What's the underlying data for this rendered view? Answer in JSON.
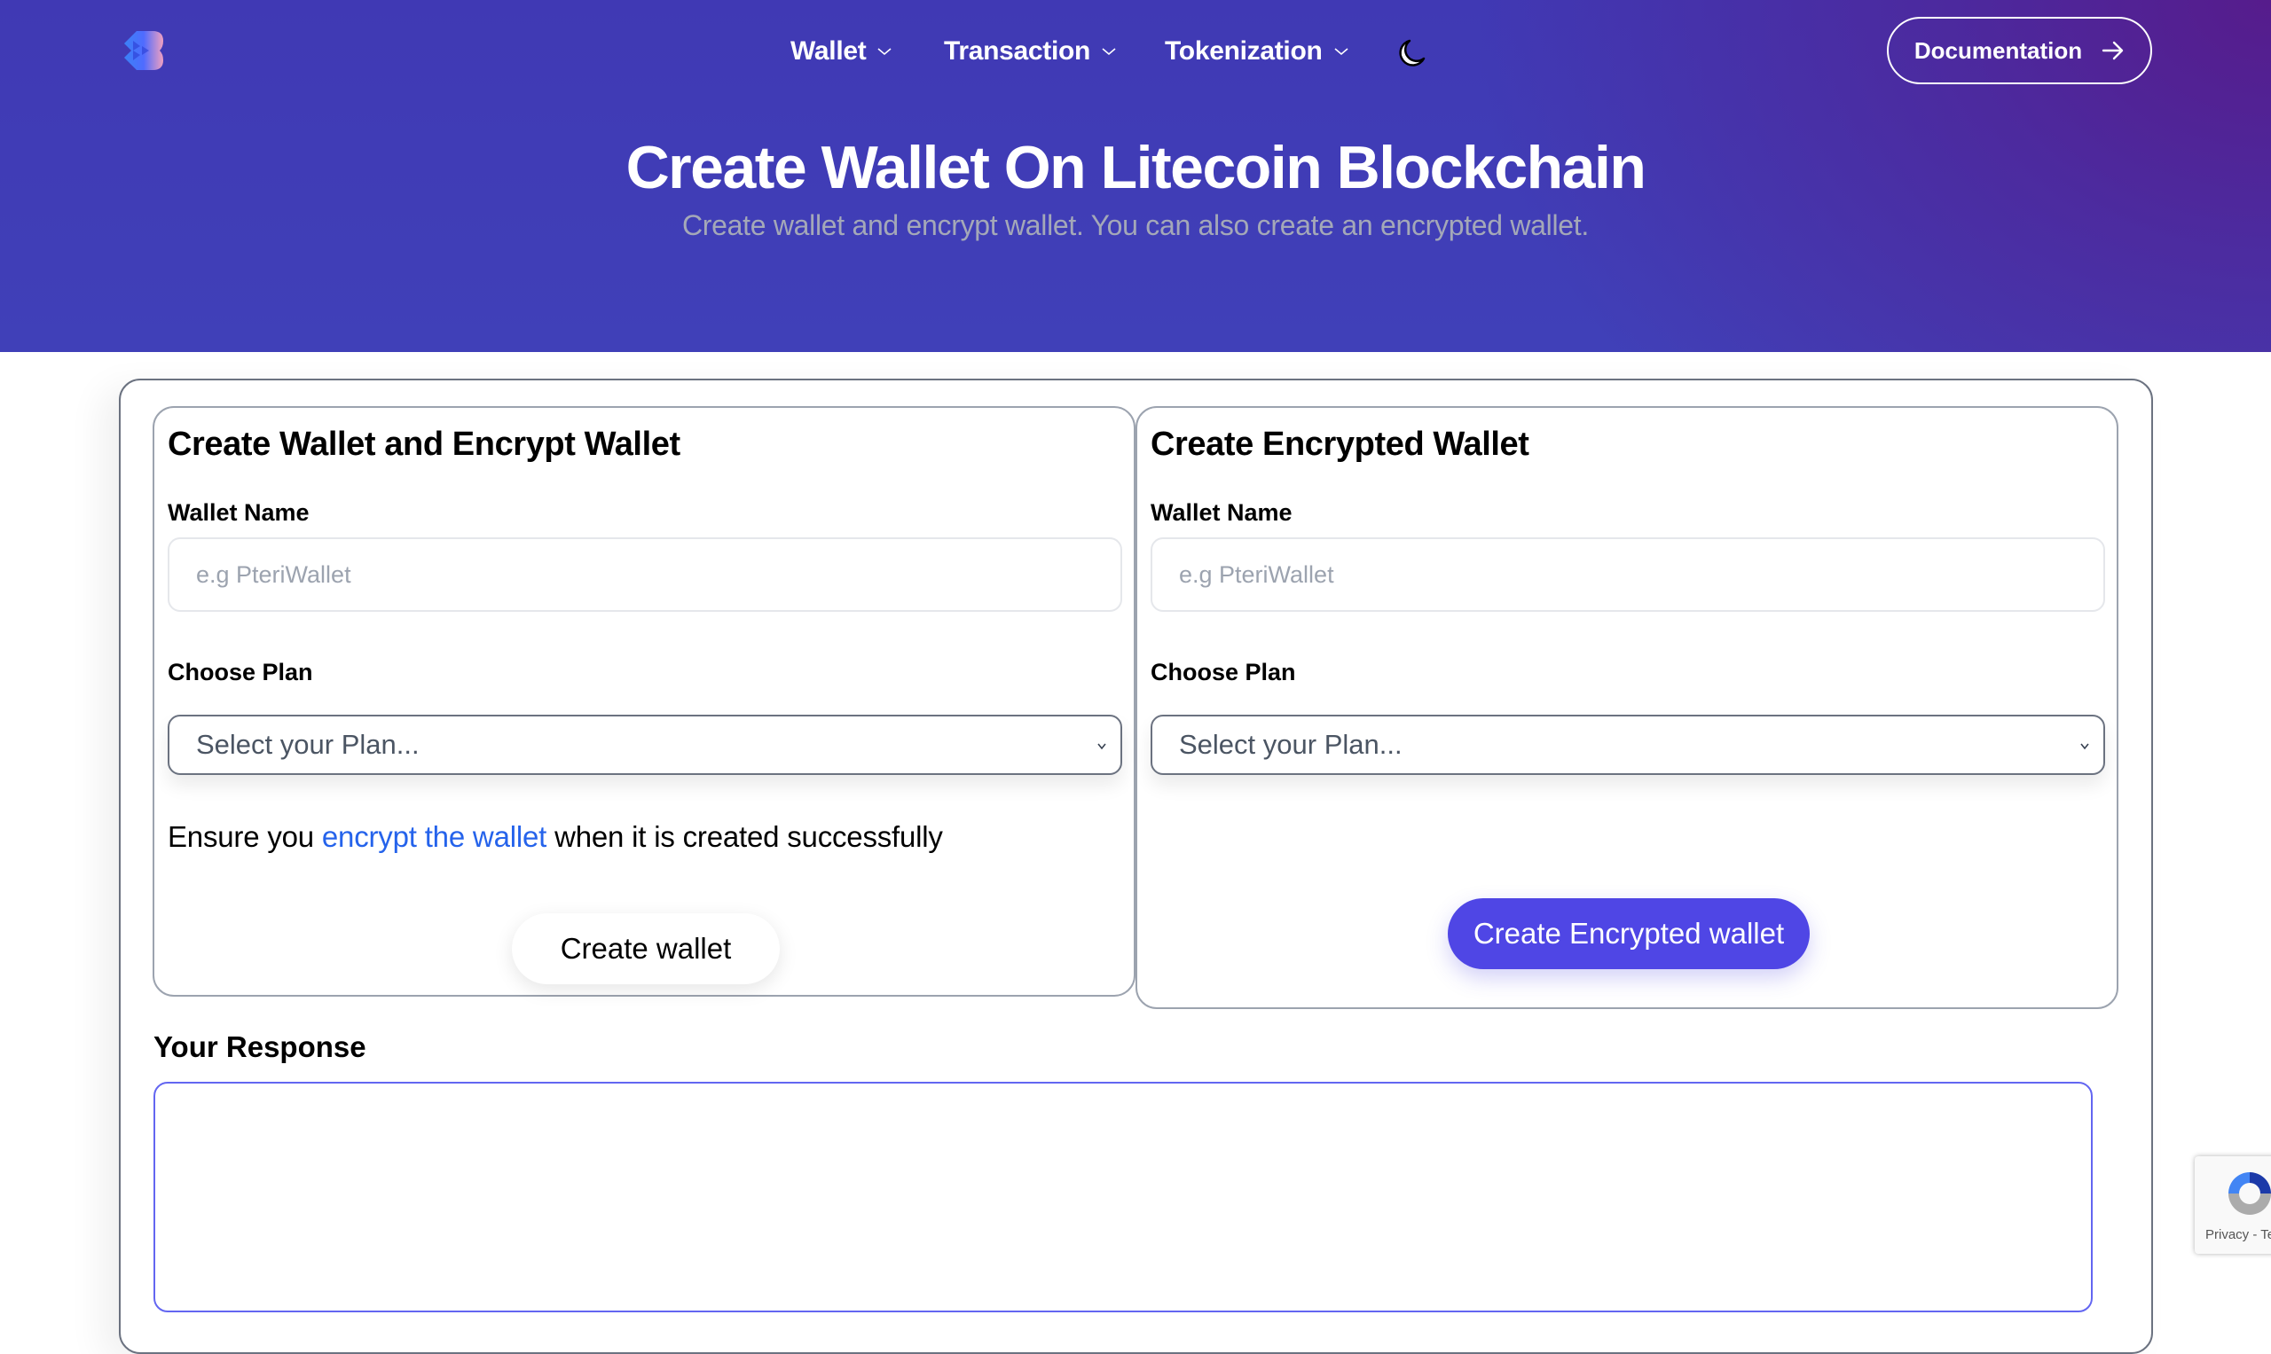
{
  "header": {
    "logo": "logo-icon",
    "nav": [
      {
        "label": "Wallet",
        "icon": "chevron-down-icon"
      },
      {
        "label": "Transaction",
        "icon": "chevron-down-icon"
      },
      {
        "label": "Tokenization",
        "icon": "chevron-down-icon"
      }
    ],
    "theme_toggle_icon": "moon-icon",
    "documentation_label": "Documentation",
    "documentation_icon": "arrow-right-icon"
  },
  "hero": {
    "title": "Create Wallet On Litecoin Blockchain",
    "subtitle": "Create wallet and encrypt wallet. You can also create an encrypted wallet."
  },
  "create_and_encrypt": {
    "title": "Create Wallet and Encrypt Wallet",
    "wallet_name_label": "Wallet Name",
    "wallet_name_placeholder": "e.g PteriWallet",
    "wallet_name_value": "",
    "plan_label": "Choose Plan",
    "plan_selected": "Select your Plan...",
    "note_before": "Ensure you ",
    "note_link": "encrypt the wallet",
    "note_after": " when it is created successfully",
    "button_label": "Create wallet"
  },
  "create_encrypted": {
    "title": "Create Encrypted Wallet",
    "wallet_name_label": "Wallet Name",
    "wallet_name_placeholder": "e.g PteriWallet",
    "wallet_name_value": "",
    "plan_label": "Choose Plan",
    "plan_selected": "Select your Plan...",
    "button_label": "Create Encrypted wallet"
  },
  "response": {
    "label": "Your Response",
    "value": ""
  },
  "recaptcha": {
    "text": "Privacy - Terms"
  },
  "colors": {
    "hero_primary": "#4040b8",
    "hero_accent": "#561c8c",
    "primary_button": "#4f46e5",
    "link": "#2563eb",
    "textarea_border": "#6366f1"
  }
}
